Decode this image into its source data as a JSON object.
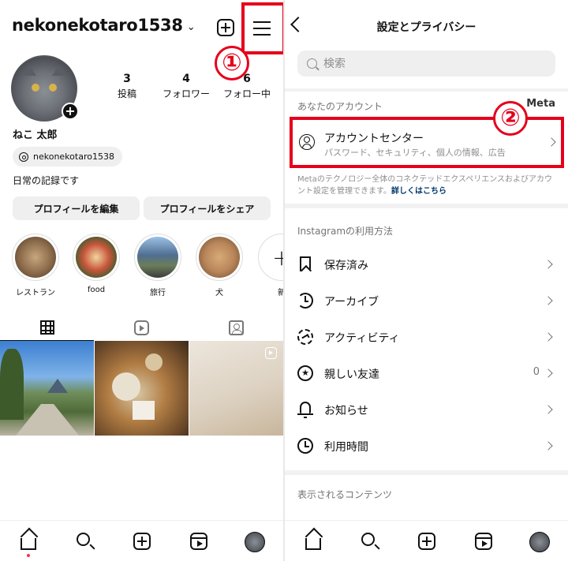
{
  "profile": {
    "username": "nekonekotaro1538",
    "display_name": "ねこ 太郎",
    "threads_handle": "nekonekotaro1538",
    "bio": "日常の記録です",
    "stats": [
      {
        "value": "3",
        "label": "投稿"
      },
      {
        "value": "4",
        "label": "フォロワー"
      },
      {
        "value": "6",
        "label": "フォロー中"
      }
    ],
    "buttons": {
      "edit": "プロフィールを編集",
      "share": "プロフィールをシェア"
    },
    "highlights": [
      {
        "label": "レストラン",
        "color": "#8a6a4a"
      },
      {
        "label": "food",
        "color": "#c8553a"
      },
      {
        "label": "旅行",
        "color": "#4f6e91"
      },
      {
        "label": "犬",
        "color": "#b9865a"
      },
      {
        "label": "新",
        "color": "#ffffff"
      }
    ],
    "annotation_1": "①"
  },
  "settings": {
    "title": "設定とプライバシー",
    "search_placeholder": "検索",
    "your_account_header": "あなたのアカウント",
    "meta_label": "Meta",
    "account_center": {
      "title": "アカウントセンター",
      "subtitle": "パスワード、セキュリティ、個人の情報、広告"
    },
    "meta_note": "Metaのテクノロジー全体のコネクテッドエクスペリエンスおよびアカウント設定を管理できます。",
    "meta_note_link": "詳しくはこちら",
    "annotation_2": "②",
    "usage_header": "Instagramの利用方法",
    "items": [
      {
        "label": "保存済み",
        "icon": "bookmark-icon",
        "count": ""
      },
      {
        "label": "アーカイブ",
        "icon": "archive-icon",
        "count": ""
      },
      {
        "label": "アクティビティ",
        "icon": "activity-icon",
        "count": ""
      },
      {
        "label": "親しい友達",
        "icon": "close-friends-star-icon",
        "count": "0"
      },
      {
        "label": "お知らせ",
        "icon": "bell-icon",
        "count": ""
      },
      {
        "label": "利用時間",
        "icon": "clock-icon",
        "count": ""
      }
    ],
    "content_header": "表示されるコンテンツ"
  },
  "colors": {
    "annotation_red": "#e5001b",
    "link_blue": "#00376b",
    "notification_dot": "#ff3040"
  }
}
